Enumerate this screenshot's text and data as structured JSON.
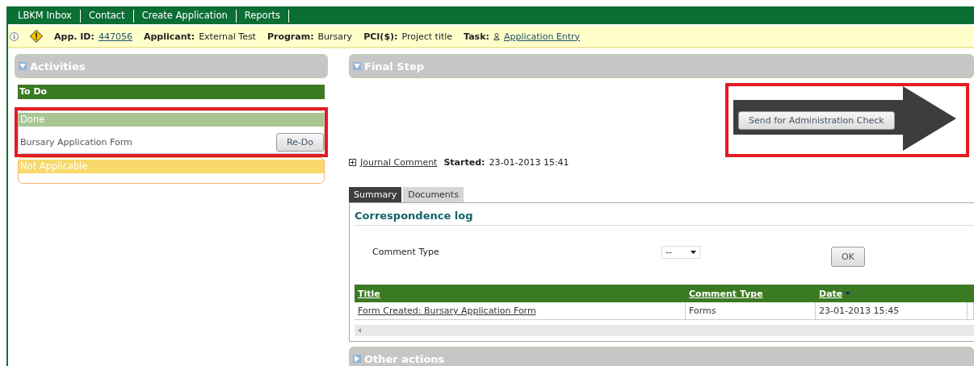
{
  "nav": [
    {
      "label": "LBKM Inbox"
    },
    {
      "label": "Contact"
    },
    {
      "label": "Create Application"
    },
    {
      "label": "Reports"
    }
  ],
  "info": [
    {
      "label": "App. ID:",
      "value": "447056",
      "kind": "link"
    },
    {
      "label": "Applicant:",
      "value": "External Test",
      "kind": "text"
    },
    {
      "label": "Program:",
      "value": "Bursary",
      "kind": "text"
    },
    {
      "label": "PCI($):",
      "value": "Project title",
      "kind": "text"
    },
    {
      "label": "Task:",
      "value": "Application Entry",
      "kind": "task"
    }
  ],
  "activities": {
    "title": "Activities",
    "expanded": true,
    "groups": [
      {
        "title": "To Do",
        "kind": "todo"
      },
      {
        "title": "Done",
        "kind": "done",
        "highlighted": true,
        "items": [
          {
            "name": "Bursary Application Form",
            "action": "Re-Do"
          }
        ]
      },
      {
        "title": "Not Applicable",
        "kind": "na",
        "highlighted": false
      }
    ]
  },
  "final_step": {
    "title": "Final Step",
    "expanded": true,
    "button": "Send for Administration Check",
    "highlighted": true,
    "journal_link": "Journal Comment",
    "started_label": "Started:",
    "started_value": "23-01-2013 15:41",
    "tabs": [
      {
        "label": "Summary",
        "selected": true
      },
      {
        "label": "Documents",
        "selected": false
      }
    ],
    "log_title": "Correspondence log",
    "filter_label": "Comment Type",
    "filter_value": "--",
    "ok_button": "OK",
    "table": {
      "columns": [
        {
          "label": "Title",
          "sorted": false
        },
        {
          "label": "Comment Type",
          "sorted": false
        },
        {
          "label": "Date",
          "sorted": true
        }
      ],
      "rows": [
        [
          "Form Created: Bursary Application Form",
          "Forms",
          "23-01-2013 15:45"
        ]
      ]
    }
  },
  "other_actions": {
    "title": "Other actions",
    "expanded": false
  }
}
